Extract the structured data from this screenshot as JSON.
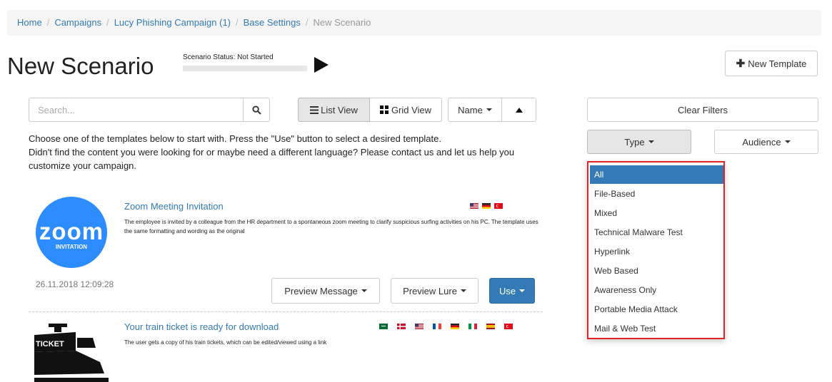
{
  "breadcrumb": {
    "home": "Home",
    "campaigns": "Campaigns",
    "campaign": "Lucy Phishing Campaign (1)",
    "base_settings": "Base Settings",
    "current": "New Scenario",
    "separator": "/"
  },
  "header": {
    "title": "New Scenario",
    "status_label": "Scenario Status:",
    "status_value": "Not Started",
    "new_template_label": "New Template"
  },
  "search": {
    "placeholder": "Search..."
  },
  "toolbar": {
    "list_view": "List View",
    "grid_view": "Grid View",
    "sort": "Name"
  },
  "intro": {
    "line1": "Choose one of the templates below to start with. Press the \"Use\" button to select a desired template.",
    "line2": "Didn't find the content you were looking for or maybe need a different language? Please contact us and let us help you customize your campaign."
  },
  "templates": [
    {
      "title": "Zoom Meeting Invitation",
      "description": "The employee is invited by a colleague from the HR department to a spontaneous zoom meeting to clarify suspicious surfing activities on his PC. The template uses the same formatting and wording as the original",
      "logo_text": "zoom",
      "logo_sub": "INVITATION",
      "date": "26.11.2018 12:09:28",
      "flags": [
        "us",
        "de",
        "tr"
      ]
    },
    {
      "title": "Your train ticket is ready for download",
      "description": "The user gets a copy of his train tickets, which can be edited/viewed using a link",
      "logo_text": "TICKET",
      "flags": [
        "sa",
        "dk",
        "us",
        "fr",
        "de",
        "it",
        "es",
        "tr"
      ]
    }
  ],
  "actions": {
    "preview_message": "Preview Message",
    "preview_lure": "Preview Lure",
    "use": "Use"
  },
  "filters": {
    "clear": "Clear Filters",
    "type": "Type",
    "audience": "Audience",
    "type_options": [
      "All",
      "File-Based",
      "Mixed",
      "Technical Malware Test",
      "Hyperlink",
      "Web Based",
      "Awareness Only",
      "Portable Media Attack",
      "Mail & Web Test"
    ]
  },
  "colors": {
    "link": "#337ab7",
    "primary": "#337ab7",
    "highlight_border": "#e0232a",
    "zoom_blue": "#2d8cff"
  }
}
